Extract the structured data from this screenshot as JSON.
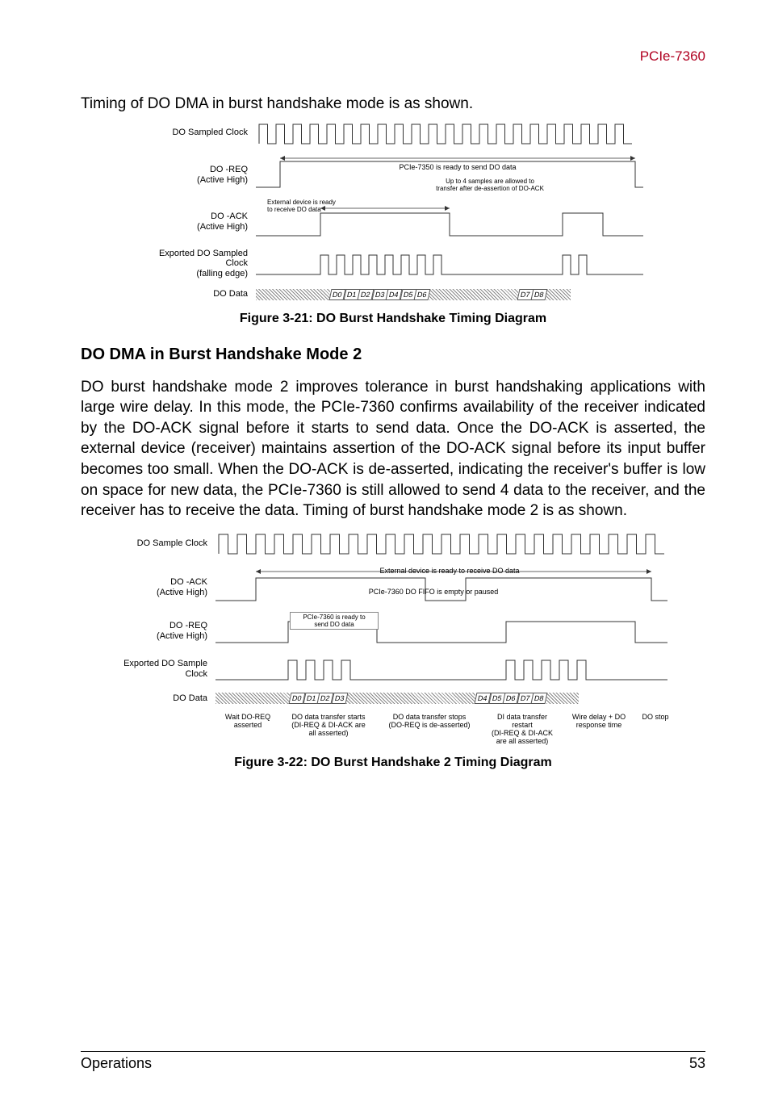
{
  "header": {
    "product": "PCIe-7360"
  },
  "intro": "Timing of DO DMA in burst handshake mode is as shown.",
  "fig1": {
    "labels": {
      "sampled_clock": "DO Sampled Clock",
      "do_req": "DO -REQ\n(Active High)",
      "do_ack": "DO -ACK\n(Active High)",
      "exported_clock": "Exported DO Sampled Clock\n(falling edge)",
      "do_data": "DO Data"
    },
    "annotations": {
      "ready_send": "PCIe-7350 is ready to send DO data",
      "allowed": "Up to 4 samples are allowed to\ntransfer after de-assertion of DO-ACK",
      "ext_ready": "External device is ready\nto receive DO data"
    },
    "data_cells": [
      "D0",
      "D1",
      "D2",
      "D3",
      "D4",
      "D5",
      "D6",
      "D7",
      "D8"
    ],
    "caption": "Figure 3-21: DO Burst Handshake Timing Diagram"
  },
  "section_heading": "DO DMA in Burst Handshake Mode 2",
  "body_para": "DO burst handshake mode 2 improves tolerance in burst handshaking applications with large wire delay. In this mode, the PCIe-7360 confirms availability of the receiver indicated by the DO-ACK signal before it starts to send data. Once the DO-ACK is asserted, the external device (receiver) maintains assertion of the DO-ACK signal before its input buffer becomes too small. When the DO-ACK is de-asserted, indicating the receiver's buffer is low on space for new data, the PCIe-7360 is still allowed to send 4 data to the receiver, and the receiver has to receive the data. Timing of burst handshake mode 2 is as shown.",
  "fig2": {
    "labels": {
      "sample_clock": "DO Sample Clock",
      "do_ack": "DO -ACK\n(Active High)",
      "do_req": "DO -REQ\n(Active High)",
      "exported_clock": "Exported DO Sample Clock",
      "do_data": "DO Data"
    },
    "annotations": {
      "ext_ready": "External device is ready to receive DO data",
      "fifo_empty": "PCIe-7360 DO FIFO is empty or paused",
      "ready_send": "PCIe-7360 is ready to\nsend DO data",
      "wait_doreq": "Wait DO-REQ\nasserted",
      "transfer_starts": "DO data transfer starts\n(DI-REQ & DI-ACK are\nall asserted)",
      "transfer_stops": "DO  data transfer stops\n(DO-REQ is de-asserted)",
      "di_restart": "DI data transfer\nrestart\n(DI-REQ & DI-ACK\nare all asserted)",
      "wire_delay": "Wire delay + DO\nresponse time",
      "do_stop": "DO stop"
    },
    "data_cells_1": [
      "D0",
      "D1",
      "D2",
      "D3"
    ],
    "data_cells_2": [
      "D4",
      "D5",
      "D6",
      "D7",
      "D8"
    ],
    "caption": "Figure 3-22: DO Burst Handshake 2 Timing Diagram"
  },
  "footer": {
    "left": "Operations",
    "right": "53"
  }
}
